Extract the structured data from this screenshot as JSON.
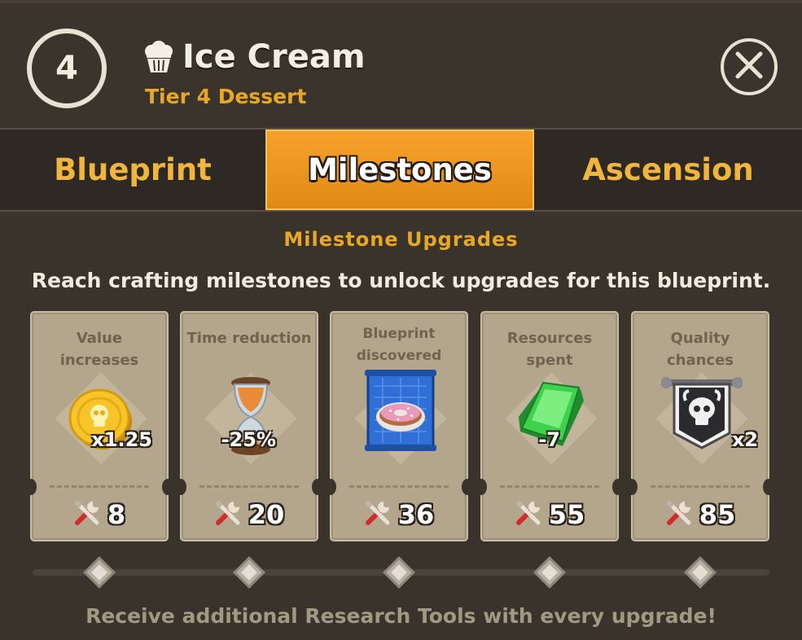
{
  "header": {
    "tier_number": "4",
    "title": "Ice Cream",
    "subtitle": "Tier 4 Dessert",
    "title_icon": "ice-cream-icon",
    "close_icon": "close-icon"
  },
  "tabs": [
    {
      "label": "Blueprint",
      "active": false
    },
    {
      "label": "Milestones",
      "active": true
    },
    {
      "label": "Ascension",
      "active": false
    }
  ],
  "section": {
    "title": "Milestone Upgrades",
    "description": "Reach crafting milestones to unlock upgrades for this blueprint."
  },
  "milestones": [
    {
      "label": "Value increases",
      "icon": "gold-coin-icon",
      "value": "x1.25",
      "cost": "8"
    },
    {
      "label_line1": "Blueprint",
      "label_line2": "discovered",
      "icon": "blueprint-donut-icon",
      "value": "",
      "cost": "36"
    },
    {
      "label": "Time reduction",
      "icon": "hourglass-icon",
      "value": "-25%",
      "cost": "20"
    },
    {
      "label": "Resources spent",
      "icon": "green-gem-icon",
      "value": "-7",
      "cost": "55"
    },
    {
      "label": "Quality chances",
      "icon": "skull-banner-icon",
      "value": "x2",
      "cost": "85"
    }
  ],
  "cost_icon": "research-tools-icon",
  "footer": "Receive additional Research Tools with every upgrade!",
  "colors": {
    "accent_orange": "#f6a22b",
    "gold_text": "#e8a824",
    "card_bg": "#b3a68c"
  }
}
